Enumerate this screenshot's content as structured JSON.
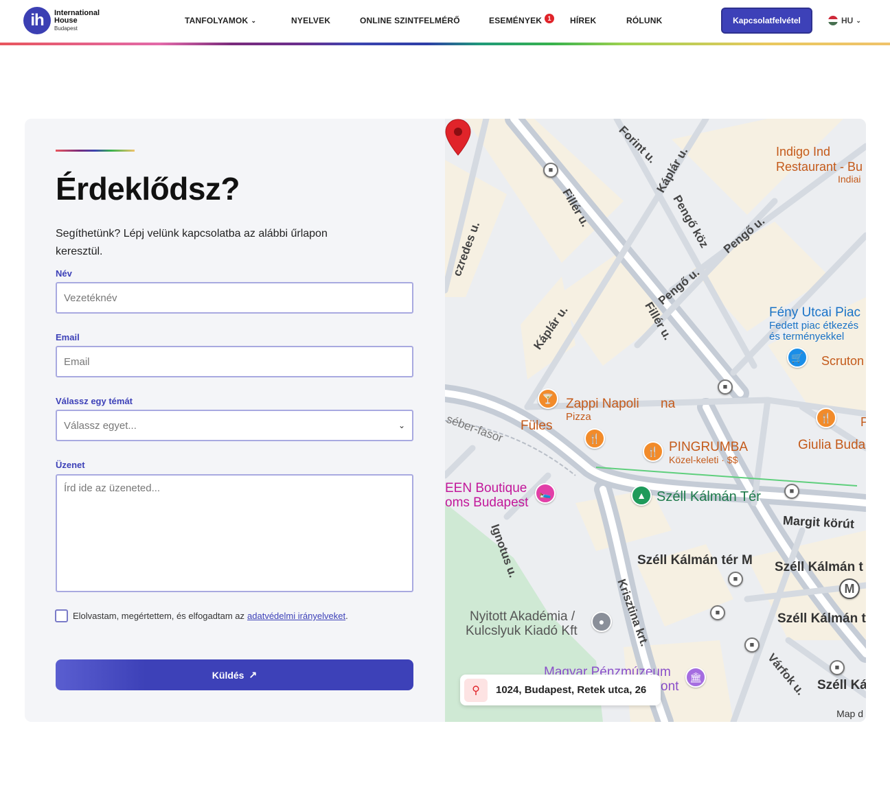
{
  "header": {
    "logo": {
      "mark": "ih",
      "line1": "International",
      "line2": "House",
      "line3": "Budapest"
    },
    "nav": [
      {
        "label": "TANFOLYAMOK",
        "has_dropdown": true
      },
      {
        "label": "NYELVEK"
      },
      {
        "label": "ONLINE SZINTFELMÉRŐ"
      },
      {
        "label": "ESEMÉNYEK",
        "badge": "1"
      },
      {
        "label": "HÍREK"
      },
      {
        "label": "RÓLUNK"
      }
    ],
    "cta_label": "Kapcsolatfelvétel",
    "language": "HU",
    "colors": {
      "brand": "#3d41b8",
      "badge": "#e0242a"
    }
  },
  "form": {
    "title": "Érdeklődsz?",
    "intro": "Segíthetünk? Lépj velünk kapcsolatba az alábbi űrlapon keresztül.",
    "name_label": "Név",
    "name_placeholder": "Vezetéknév",
    "email_label": "Email",
    "email_placeholder": "Email",
    "topic_label": "Válassz egy témát",
    "topic_selected": "Válassz egyet...",
    "message_label": "Üzenet",
    "message_placeholder": "Írd ide az üzeneted...",
    "consent_text": "Elolvastam, megértettem, és elfogadtam az",
    "consent_link": "adatvédelmi irányelveket",
    "consent_end": ".",
    "submit_label": "Küldés"
  },
  "map": {
    "address": "1024, Budapest, Retek utca, 26",
    "map_data_label": "Map d",
    "streets": [
      "Forint u.",
      "Káplár u.",
      "Fillér u.",
      "Pengő köz",
      "Pengő u.",
      "Pengő u.",
      "czredes u.",
      "Káplár u.",
      "Fillér u.",
      "Margit körút",
      "séber-fasor",
      "Ignotus u.",
      "Krisztina krt.",
      "Várfok u."
    ],
    "places": {
      "indigo_line1": "Indigo Ind",
      "indigo_line2": "Restaurant - Bu",
      "indigo_line3": "Indiai",
      "feny_title": "Fény Utcai Piac",
      "feny_sub1": "Fedett piac étkezés",
      "feny_sub2": "és terményekkel",
      "scruton": "Scruton",
      "zappi": "Zappi Napoli",
      "zappi_end": "na",
      "zappi_sub": "Pizza",
      "fules": "Füles",
      "pingrumba": "PINGRUMBA",
      "pingrumba_sub": "Közel-keleti · $$",
      "giulia": "Giulia Buda",
      "p_right": "P",
      "boutique1": "EEN Boutique",
      "boutique2": "oms Budapest",
      "szell_ter": "Széll Kálmán Tér",
      "szell_m": "Széll Kálmán tér M",
      "szell_t1": "Széll Kálmán t",
      "szell_t2": "Széll Kálmán t",
      "szell_k": "Széll Ká",
      "nyitott1": "Nyitott Akadémia /",
      "nyitott2": "Kulcslyuk Kiadó Kft",
      "muzeum": "Magyar Pénzmúzeum",
      "muzeum2": "ont",
      "metro": "M"
    }
  }
}
